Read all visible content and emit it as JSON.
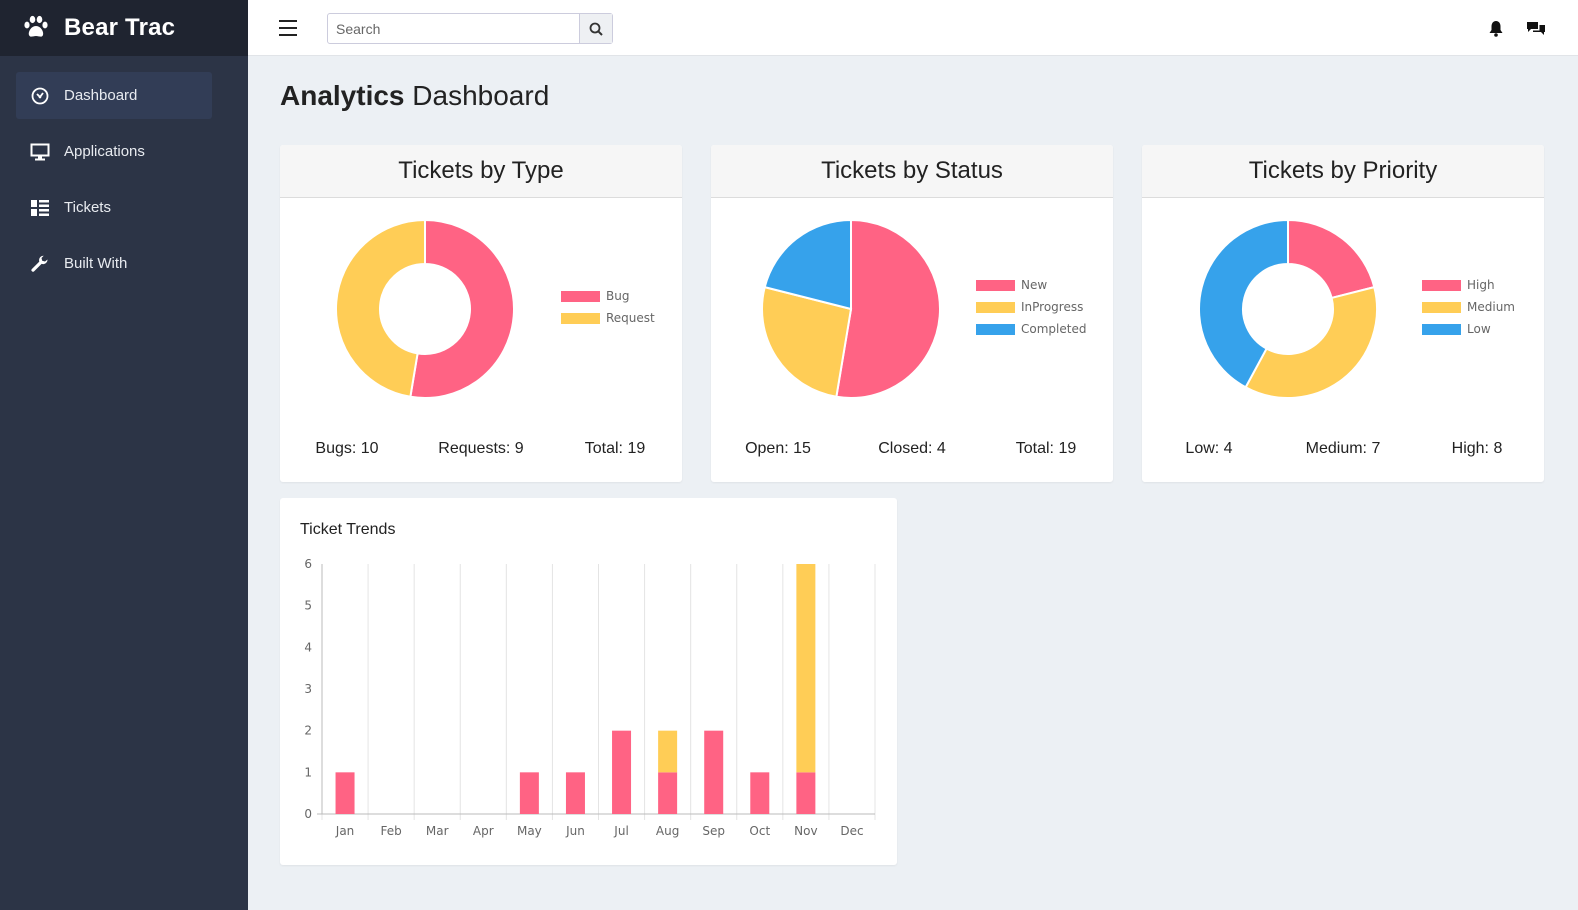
{
  "brand": {
    "title": "Bear Trac",
    "icon": "paw-icon"
  },
  "sidebar": {
    "items": [
      {
        "label": "Dashboard",
        "icon": "dashboard-icon",
        "active": true
      },
      {
        "label": "Applications",
        "icon": "monitor-icon",
        "active": false
      },
      {
        "label": "Tickets",
        "icon": "list-icon",
        "active": false
      },
      {
        "label": "Built With",
        "icon": "wrench-icon",
        "active": false
      }
    ]
  },
  "topbar": {
    "search_placeholder": "Search",
    "icons": [
      "menu-icon",
      "search-icon",
      "bell-icon",
      "chat-icon"
    ]
  },
  "page": {
    "title_bold": "Analytics",
    "title_rest": "Dashboard"
  },
  "colors": {
    "pink": "#ff6384",
    "yellow": "#ffcd56",
    "blue": "#36a2eb"
  },
  "cards": {
    "type": {
      "title": "Tickets by Type",
      "legend": [
        "Bug",
        "Request"
      ],
      "stats": [
        "Bugs: 10",
        "Requests: 9",
        "Total: 19"
      ]
    },
    "status": {
      "title": "Tickets by Status",
      "legend": [
        "New",
        "InProgress",
        "Completed"
      ],
      "stats": [
        "Open: 15",
        "Closed: 4",
        "Total: 19"
      ]
    },
    "priority": {
      "title": "Tickets by Priority",
      "legend": [
        "High",
        "Medium",
        "Low"
      ],
      "stats": [
        "Low: 4",
        "Medium: 7",
        "High: 8"
      ]
    }
  },
  "chart_data": [
    {
      "type": "pie",
      "donut": true,
      "title": "Tickets by Type",
      "labels": [
        "Bug",
        "Request"
      ],
      "values": [
        10,
        9
      ],
      "colors": [
        "#ff6384",
        "#ffcd56"
      ]
    },
    {
      "type": "pie",
      "donut": false,
      "title": "Tickets by Status",
      "labels": [
        "New",
        "InProgress",
        "Completed"
      ],
      "values": [
        10,
        5,
        4
      ],
      "colors": [
        "#ff6384",
        "#ffcd56",
        "#36a2eb"
      ]
    },
    {
      "type": "pie",
      "donut": true,
      "title": "Tickets by Priority",
      "labels": [
        "High",
        "Medium",
        "Low"
      ],
      "values": [
        4,
        7,
        8
      ],
      "colors": [
        "#ff6384",
        "#ffcd56",
        "#36a2eb"
      ]
    },
    {
      "type": "bar",
      "stacked": true,
      "title": "Ticket Trends",
      "categories": [
        "Jan",
        "Feb",
        "Mar",
        "Apr",
        "May",
        "Jun",
        "Jul",
        "Aug",
        "Sep",
        "Oct",
        "Nov",
        "Dec"
      ],
      "series": [
        {
          "values": [
            1,
            0,
            0,
            0,
            1,
            1,
            2,
            1,
            2,
            1,
            1,
            0
          ],
          "color": "#ff6384"
        },
        {
          "values": [
            0,
            0,
            0,
            0,
            0,
            0,
            0,
            1,
            0,
            0,
            5,
            0
          ],
          "color": "#ffcd56"
        }
      ],
      "ylim": [
        0,
        6
      ],
      "yticks": [
        0,
        1,
        2,
        3,
        4,
        5,
        6
      ],
      "grid": "vertical"
    }
  ]
}
